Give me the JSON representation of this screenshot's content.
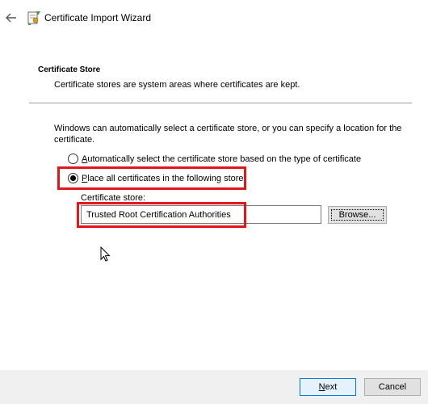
{
  "window": {
    "title": "Certificate Import Wizard",
    "back_icon": "back-arrow-icon",
    "app_icon": "certificate-wizard-icon"
  },
  "section": {
    "title": "Certificate Store",
    "description": "Certificate stores are system areas where certificates are kept."
  },
  "intro": "Windows can automatically select a certificate store, or you can specify a location for the certificate.",
  "options": [
    {
      "mnemonic": "A",
      "rest": "utomatically select the certificate store based on the type of certificate",
      "checked": false
    },
    {
      "mnemonic": "P",
      "rest": "lace all certificates in the following store",
      "checked": true
    }
  ],
  "store": {
    "label": "Certificate store:",
    "value": "Trusted Root Certification Authorities",
    "browse_label": "Browse..."
  },
  "footer": {
    "next_mnemonic": "N",
    "next_rest": "ext",
    "cancel_label": "Cancel"
  },
  "colors": {
    "highlight": "#e3161b",
    "footer_bg": "#f0f0f0",
    "default_button_border": "#0078d7"
  }
}
